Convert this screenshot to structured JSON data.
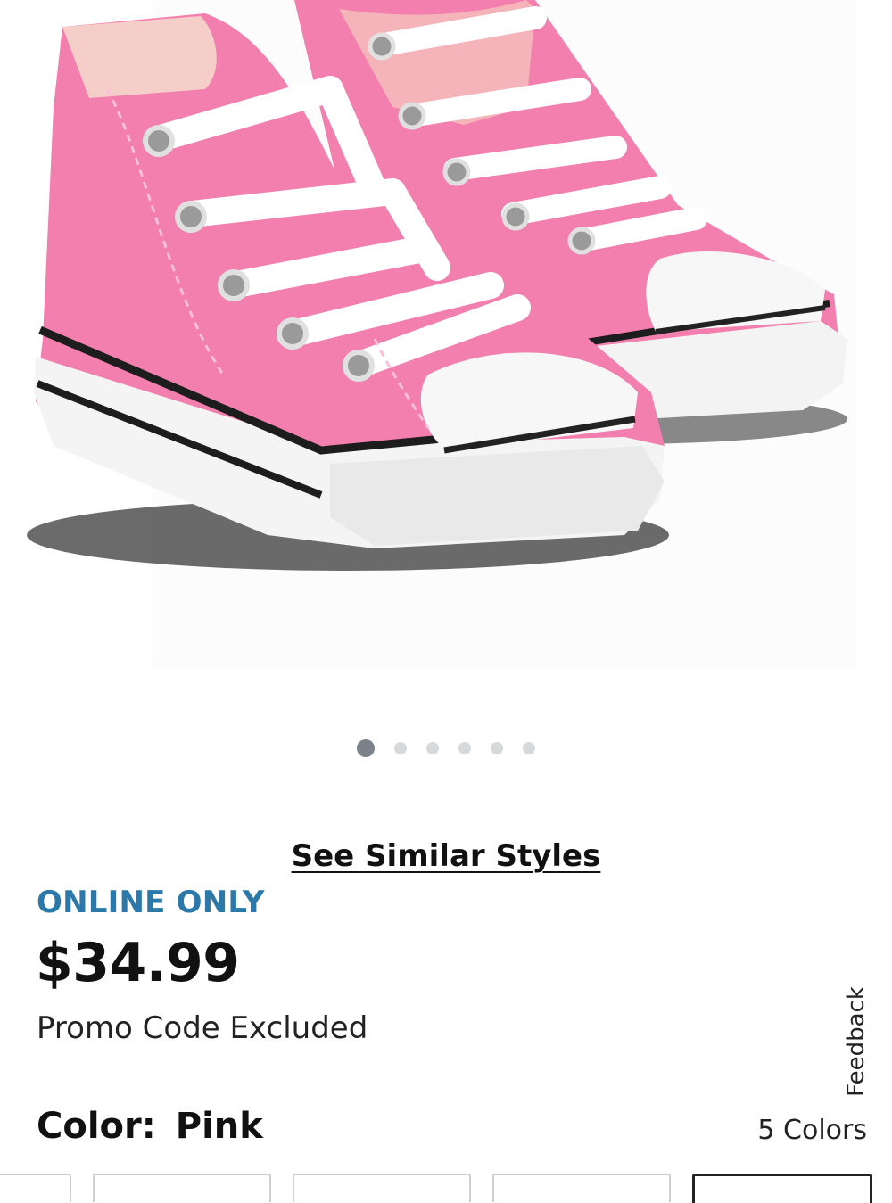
{
  "product": {
    "image_alt": "Pink high-top canvas sneakers",
    "carousel": {
      "count": 6,
      "active_index": 0
    },
    "see_similar_label": "See Similar Styles",
    "badge": "ONLINE ONLY",
    "price": "$34.99",
    "promo_note": "Promo Code Excluded",
    "color_label": "Color:",
    "color_value": "Pink",
    "color_count": "5 Colors",
    "feedback_label": "Feedback"
  },
  "colors": {
    "accent_blue": "#2a79aa",
    "shoe_pink": "#f27fae",
    "dot_active": "#7c8289",
    "dot_inactive": "#d8d9db"
  }
}
